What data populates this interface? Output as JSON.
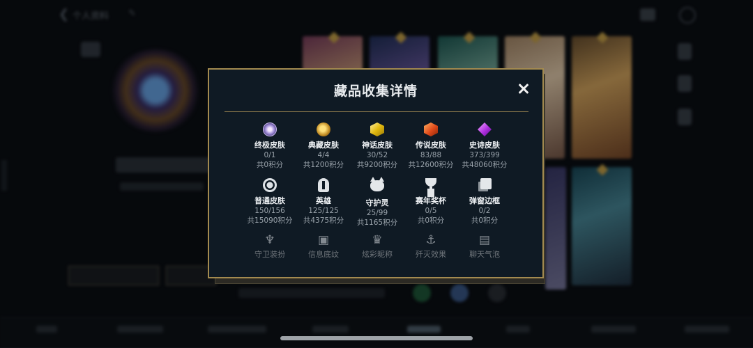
{
  "background": {
    "top_title": "个人资料"
  },
  "modal": {
    "title": "藏品收集详情",
    "rows": [
      [
        {
          "id": "ultimate",
          "name": "终极皮肤",
          "count": "0/1",
          "points": "共0积分",
          "icon": "ultimate-gem-icon"
        },
        {
          "id": "collector",
          "name": "典藏皮肤",
          "count": "4/4",
          "points": "共1200积分",
          "icon": "dragon-emblem-icon"
        },
        {
          "id": "mythic",
          "name": "神话皮肤",
          "count": "30/52",
          "points": "共9200积分",
          "icon": "gold-gem-icon"
        },
        {
          "id": "legendary",
          "name": "传说皮肤",
          "count": "83/88",
          "points": "共12600积分",
          "icon": "orange-gem-icon"
        },
        {
          "id": "epic",
          "name": "史诗皮肤",
          "count": "373/399",
          "points": "共48060积分",
          "icon": "purple-gem-icon"
        }
      ],
      [
        {
          "id": "normal",
          "name": "普通皮肤",
          "count": "150/156",
          "points": "共15090积分",
          "icon": "ring-icon"
        },
        {
          "id": "heroes",
          "name": "英雄",
          "count": "125/125",
          "points": "共4375积分",
          "icon": "helmet-icon"
        },
        {
          "id": "guardians",
          "name": "守护灵",
          "count": "25/99",
          "points": "共1165积分",
          "icon": "guardian-cat-icon"
        },
        {
          "id": "trophies",
          "name": "赛年奖杯",
          "count": "0/5",
          "points": "共0积分",
          "icon": "trophy-icon"
        },
        {
          "id": "frames",
          "name": "弹窗边框",
          "count": "0/2",
          "points": "共0积分",
          "icon": "frame-icon"
        }
      ],
      [
        {
          "id": "ward",
          "name": "守卫装扮",
          "icon": "ward-icon"
        },
        {
          "id": "info",
          "name": "信息底纹",
          "icon": "info-card-icon"
        },
        {
          "id": "title",
          "name": "炫彩昵称",
          "icon": "crown-icon"
        },
        {
          "id": "recall",
          "name": "歼灭效果",
          "icon": "anchor-icon"
        },
        {
          "id": "chat",
          "name": "聊天气泡",
          "icon": "chat-bubble-icon"
        }
      ]
    ]
  }
}
